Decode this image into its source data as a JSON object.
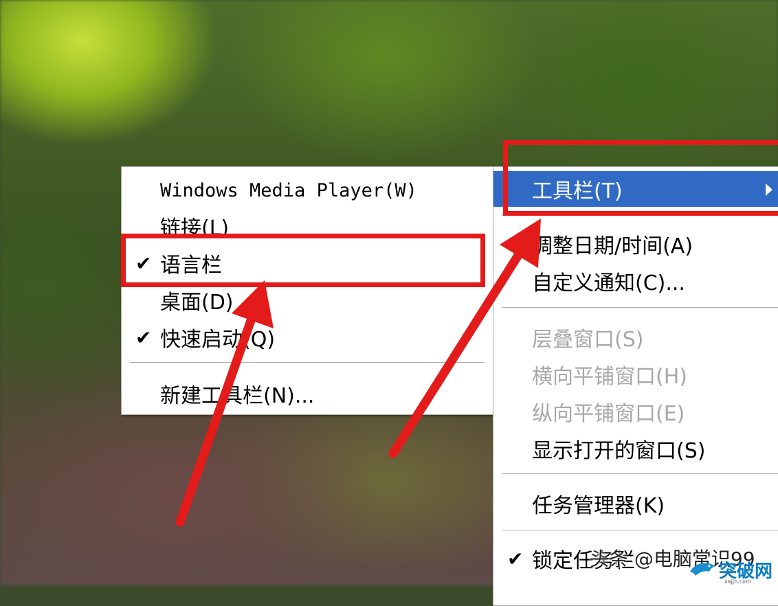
{
  "left_menu": {
    "items": [
      {
        "label": "Windows Media Player(W)",
        "checked": false
      },
      {
        "label": "链接(L)",
        "checked": false
      },
      {
        "label": "语言栏",
        "checked": true
      },
      {
        "label": "桌面(D)",
        "checked": false
      },
      {
        "label": "快速启动(Q)",
        "checked": true
      },
      {
        "label": "新建工具栏(N)...",
        "checked": false
      }
    ],
    "check_mark": "✔"
  },
  "right_menu": {
    "items": [
      {
        "label": "工具栏(T)",
        "selected": true,
        "has_submenu": true
      },
      {
        "label": "调整日期/时间(A)"
      },
      {
        "label": "自定义通知(C)..."
      },
      {
        "label": "层叠窗口(S)",
        "disabled": true
      },
      {
        "label": "横向平铺窗口(H)",
        "disabled": true
      },
      {
        "label": "纵向平铺窗口(E)",
        "disabled": true
      },
      {
        "label": "显示打开的窗口(S)"
      },
      {
        "label": "任务管理器(K)"
      },
      {
        "label": "锁定任务栏",
        "checked": true
      }
    ],
    "check_mark": "✔"
  },
  "annotations": {
    "highlight_color": "#e41b1b",
    "selection_color": "#316ac5"
  },
  "watermark": {
    "text": "头条 @电脑常识99",
    "logo_text": "突破网",
    "logo_sub": "xajjn.com",
    "logo_icon": "dolphin-icon"
  }
}
